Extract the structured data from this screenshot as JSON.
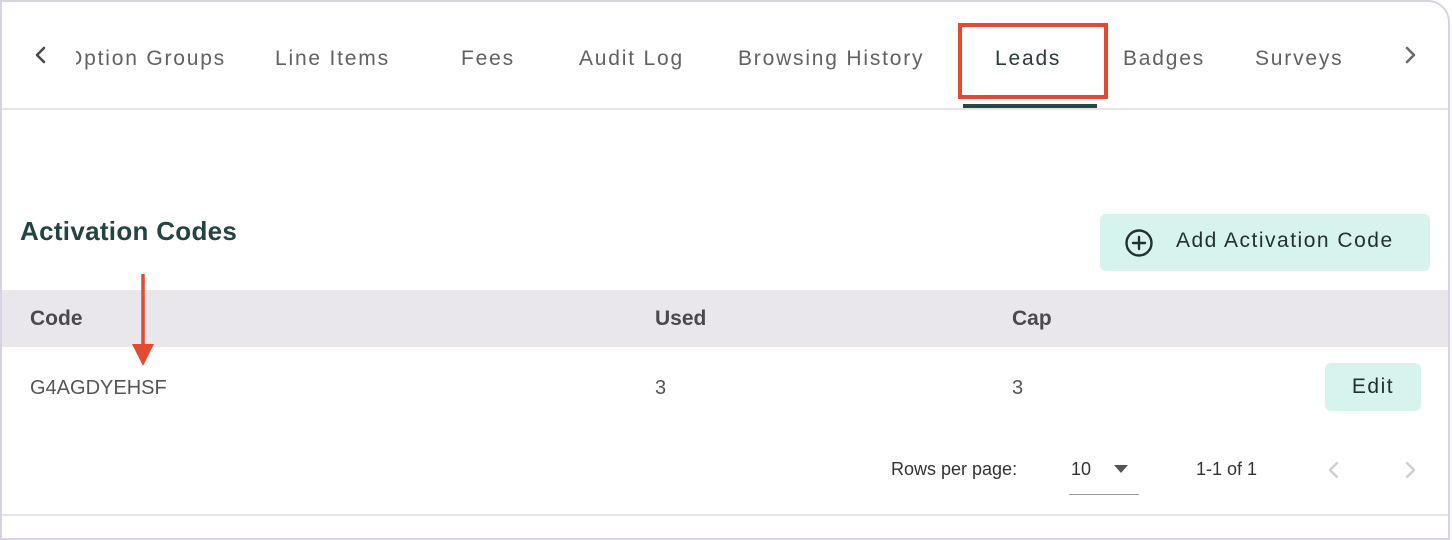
{
  "tabs": {
    "items": [
      {
        "label": "Option Groups"
      },
      {
        "label": "Line Items"
      },
      {
        "label": "Fees"
      },
      {
        "label": "Audit Log"
      },
      {
        "label": "Browsing History"
      },
      {
        "label": "Leads"
      },
      {
        "label": "Badges"
      },
      {
        "label": "Surveys"
      }
    ],
    "active": "Leads",
    "prev_icon": "chevron-left-icon",
    "next_icon": "chevron-right-icon"
  },
  "section": {
    "title": "Activation Codes",
    "add_button_label": "Add Activation Code",
    "add_icon": "plus-circle-icon"
  },
  "table": {
    "columns": [
      "Code",
      "Used",
      "Cap"
    ],
    "rows": [
      {
        "code": "G4AGDYEHSF",
        "used": "3",
        "cap": "3",
        "action": "Edit"
      }
    ]
  },
  "pagination": {
    "rows_per_page_label": "Rows per page:",
    "rows_per_page_value": "10",
    "range": "1-1 of 1"
  },
  "colors": {
    "accent": "#274745",
    "button_bg": "#d7f3ee",
    "highlight": "#e34a32",
    "header_bg": "#e9e7ec"
  }
}
